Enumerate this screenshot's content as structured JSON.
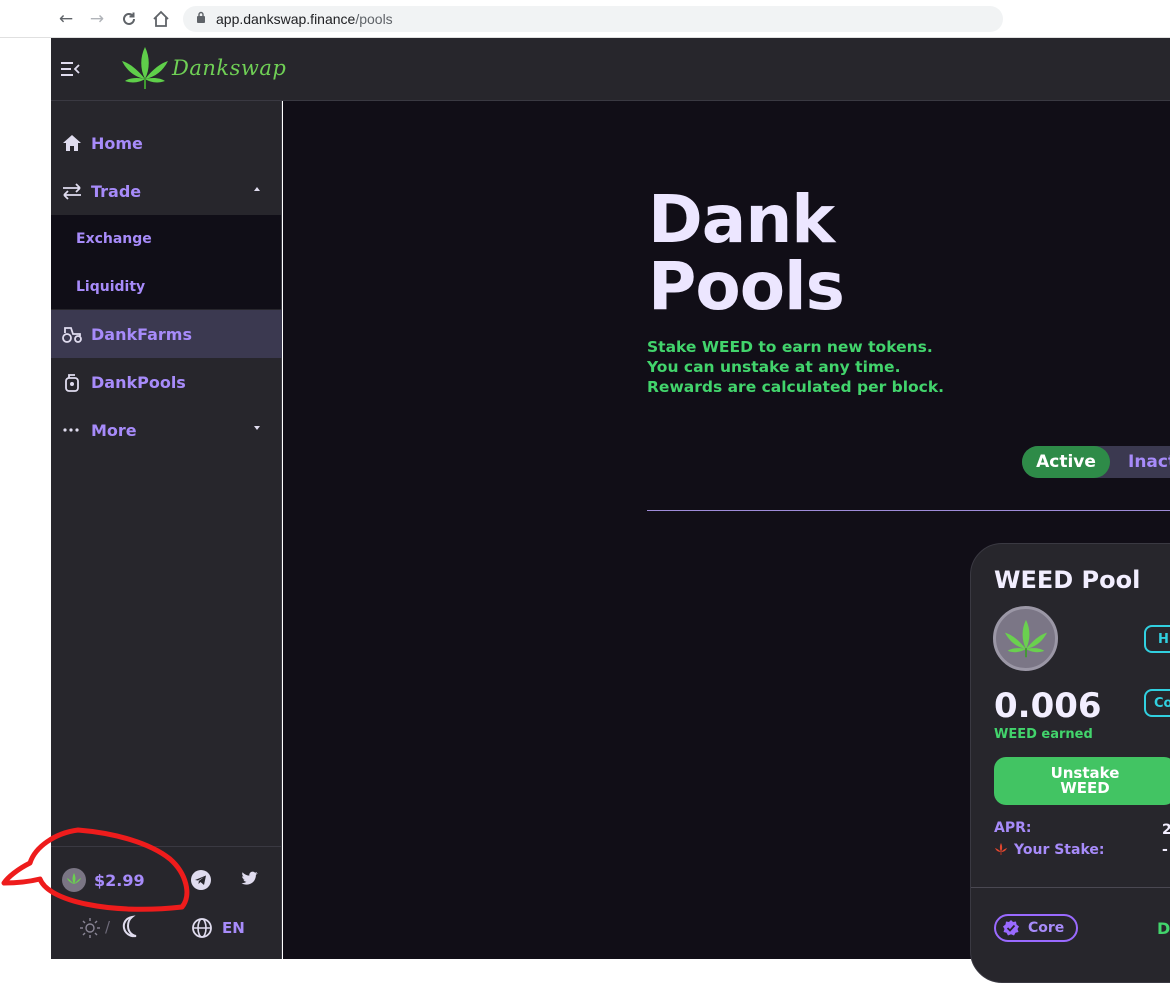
{
  "browser": {
    "url_host": "app.dankswap.finance",
    "url_path": "/pools"
  },
  "header": {
    "logo_text": "Dankswap"
  },
  "sidebar": {
    "items": [
      {
        "label": "Home",
        "icon": "home-icon"
      },
      {
        "label": "Trade",
        "icon": "swap-icon"
      },
      {
        "label": "DankFarms",
        "icon": "tractor-icon"
      },
      {
        "label": "DankPools",
        "icon": "pool-icon"
      },
      {
        "label": "More",
        "icon": "ellipsis-icon"
      }
    ],
    "trade_sub": [
      "Exchange",
      "Liquidity"
    ],
    "price": "$2.99",
    "lang": "EN"
  },
  "hero": {
    "title_line1": "Dank",
    "title_line2": "Pools",
    "desc": [
      "Stake WEED to earn new tokens.",
      "You can unstake at any time.",
      "Rewards are calculated per block."
    ]
  },
  "toggle": {
    "active": "Active",
    "inactive": "Inact"
  },
  "card": {
    "title": "WEED Pool",
    "tag1": "H",
    "tag2": "Co",
    "earned": "0.006",
    "earned_label": "WEED earned",
    "unstake_line1": "Unstake",
    "unstake_line2": "WEED",
    "apr_label": "APR:",
    "apr_value": "2",
    "stake_label": "Your Stake:",
    "stake_value": "-",
    "core_label": "Core",
    "details_letter": "D"
  },
  "colors": {
    "accent_purple": "#a78bfa",
    "accent_green": "#42d46c",
    "bg_dark": "#110e17",
    "panel": "#27262c"
  }
}
